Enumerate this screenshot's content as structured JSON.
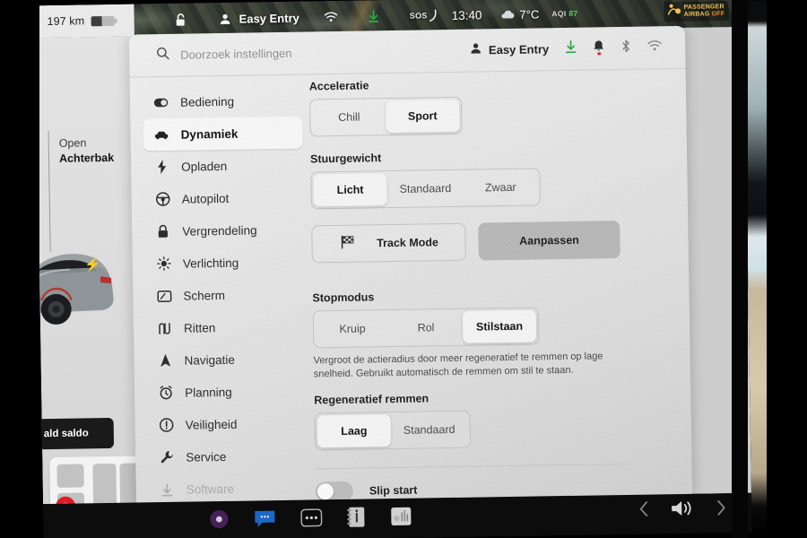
{
  "car_status_bar": {
    "range": "197 km",
    "battery_icon": "battery-icon",
    "lock_icon": "lock-open-icon",
    "profile_icon": "person-icon",
    "profile_name": "Easy Entry",
    "wifi_icon": "wifi-icon",
    "download_icon": "download-arrow-icon",
    "sos_label": "SOS",
    "time": "13:40",
    "weather_icon": "cloud-icon",
    "temperature": "7°C",
    "aqi_label": "AQI",
    "aqi_value": "87",
    "airbag_icon": "passenger-airbag-icon",
    "airbag_line1": "PASSENGER",
    "airbag_line2": "AIRBAG",
    "airbag_state": "OFF"
  },
  "left_panel": {
    "open_word": "Open",
    "open_target": "Achterbak",
    "charge_bolt_icon": "charge-bolt-icon",
    "car_image_name": "tesla-model-3-rear-image",
    "tooltip_text": "ald saldo",
    "child_seat_icon": "child-seat-warning-icon"
  },
  "settings": {
    "search": {
      "icon": "search-icon",
      "placeholder": "Doorzoek instellingen",
      "value": ""
    },
    "header_icons": {
      "profile_icon": "person-icon",
      "profile_name": "Easy Entry",
      "download_icon": "download-arrow-icon",
      "bell_icon": "bell-icon",
      "bluetooth_icon": "bluetooth-icon",
      "wifi_icon": "wifi-icon"
    },
    "nav": [
      {
        "label": "Bediening",
        "icon": "toggle-icon",
        "state": "normal"
      },
      {
        "label": "Dynamiek",
        "icon": "car-icon",
        "state": "active"
      },
      {
        "label": "Opladen",
        "icon": "bolt-icon",
        "state": "normal"
      },
      {
        "label": "Autopilot",
        "icon": "steering-icon",
        "state": "normal"
      },
      {
        "label": "Vergrendeling",
        "icon": "lock-icon",
        "state": "normal"
      },
      {
        "label": "Verlichting",
        "icon": "brightness-icon",
        "state": "normal"
      },
      {
        "label": "Scherm",
        "icon": "display-icon",
        "state": "normal"
      },
      {
        "label": "Ritten",
        "icon": "route-icon",
        "state": "normal"
      },
      {
        "label": "Navigatie",
        "icon": "navigation-icon",
        "state": "normal"
      },
      {
        "label": "Planning",
        "icon": "alarm-icon",
        "state": "normal"
      },
      {
        "label": "Veiligheid",
        "icon": "info-icon",
        "state": "normal"
      },
      {
        "label": "Service",
        "icon": "wrench-icon",
        "state": "normal"
      },
      {
        "label": "Software",
        "icon": "download-icon",
        "state": "dim"
      }
    ],
    "sections": {
      "acceleration": {
        "title": "Acceleratie",
        "options": [
          {
            "label": "Chill",
            "selected": false
          },
          {
            "label": "Sport",
            "selected": true
          }
        ]
      },
      "steering_weight": {
        "title": "Stuurgewicht",
        "options": [
          {
            "label": "Licht",
            "selected": true
          },
          {
            "label": "Standaard",
            "selected": false
          },
          {
            "label": "Zwaar",
            "selected": false
          }
        ]
      },
      "track_mode": {
        "icon": "checkered-flag-icon",
        "label": "Track Mode",
        "adjust_label": "Aanpassen"
      },
      "stop_mode": {
        "title": "Stopmodus",
        "options": [
          {
            "label": "Kruip",
            "selected": false
          },
          {
            "label": "Rol",
            "selected": false
          },
          {
            "label": "Stilstaan",
            "selected": true
          }
        ],
        "description": "Vergroot de actieradius door meer regeneratief te remmen op lage snelheid. Gebruikt automatisch de remmen om stil te staan."
      },
      "regen_braking": {
        "title": "Regeneratief remmen",
        "options": [
          {
            "label": "Laag",
            "selected": true
          },
          {
            "label": "Standaard",
            "selected": false
          }
        ]
      },
      "slip_start": {
        "label": "Slip start",
        "enabled": false
      }
    }
  },
  "dock": {
    "items": [
      {
        "icon": "media-icon"
      },
      {
        "icon": "messages-icon"
      },
      {
        "icon": "more-dots-icon"
      },
      {
        "icon": "info-card-icon"
      },
      {
        "icon": "tuner-icon"
      }
    ],
    "back_icon": "chevron-left-icon",
    "volume_icon": "volume-icon",
    "forward_icon": "chevron-right-icon"
  }
}
